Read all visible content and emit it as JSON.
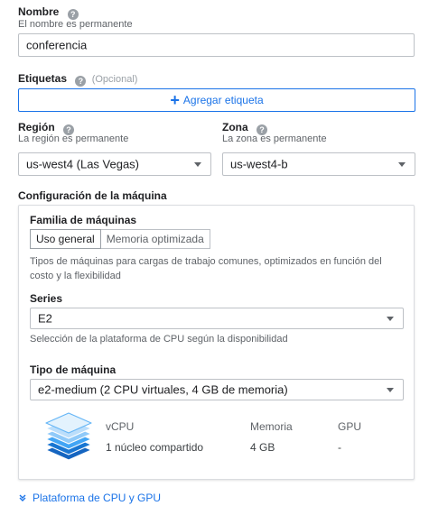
{
  "name": {
    "label": "Nombre",
    "hint": "El nombre es permanente",
    "value": "conferencia"
  },
  "labels": {
    "label": "Etiquetas",
    "optional": "(Opcional)",
    "add_button": "Agregar etiqueta"
  },
  "region": {
    "label": "Región",
    "hint": "La región es permanente",
    "value": "us-west4 (Las Vegas)"
  },
  "zone": {
    "label": "Zona",
    "hint": "La zona es permanente",
    "value": "us-west4-b"
  },
  "machine_config": {
    "title": "Configuración de la máquina",
    "family_label": "Familia de máquinas",
    "tabs": [
      "Uso general",
      "Memoria optimizada"
    ],
    "family_description": "Tipos de máquinas para cargas de trabajo comunes, optimizados en función del costo y la flexibilidad",
    "series_label": "Series",
    "series_value": "E2",
    "series_hint": "Selección de la plataforma de CPU según la disponibilidad",
    "machine_type_label": "Tipo de máquina",
    "machine_type_value": "e2-medium (2 CPU virtuales, 4 GB de memoria)",
    "specs": {
      "headers": [
        "vCPU",
        "Memoria",
        "GPU"
      ],
      "values": [
        "1 núcleo compartido",
        "4 GB",
        "-"
      ]
    }
  },
  "cpu_platform_link": "Plataforma de CPU y GPU",
  "icons": {
    "help": "help-icon",
    "add": "plus-icon",
    "dropdown": "caret-down-icon",
    "machine": "stacked-layers-icon",
    "expand": "chevron-down-icon"
  },
  "colors": {
    "accent": "#1a73e8",
    "hint_text": "#5f6368",
    "border": "#bdc1c6"
  }
}
